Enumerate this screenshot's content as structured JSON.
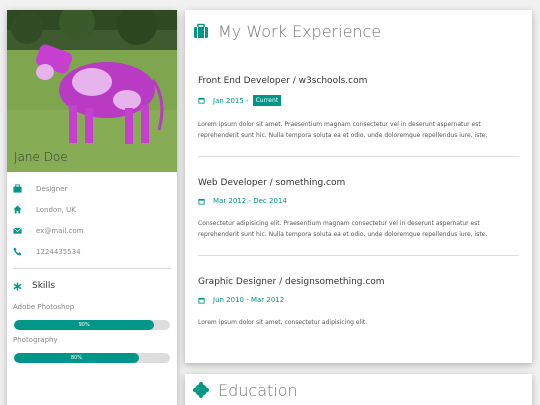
{
  "profile": {
    "name": "Jane Doe",
    "info": [
      {
        "icon": "briefcase-icon",
        "text": "Designer"
      },
      {
        "icon": "home-icon",
        "text": "London, UK"
      },
      {
        "icon": "envelope-icon",
        "text": "ex@mail.com"
      },
      {
        "icon": "phone-icon",
        "text": "1224435534"
      }
    ],
    "skills_title": "Skills",
    "skills": [
      {
        "label": "Adobe Photoshop",
        "percent": 90,
        "percent_label": "90%"
      },
      {
        "label": "Photography",
        "percent": 80,
        "percent_label": "80%"
      }
    ]
  },
  "work": {
    "title": "My Work Experience",
    "jobs": [
      {
        "title": "Front End Developer / w3schools.com",
        "date": "Jan 2015 -",
        "badge": "Current",
        "desc": "Lorem ipsum dolor sit amet. Praesentium magnam consectetur vel in deserunt aspernatur est reprehenderit sunt hic. Nulla tempora soluta ea et odio, unde doloremque repellendus iure, iste."
      },
      {
        "title": "Web Developer / something.com",
        "date": "Mar 2012 - Dec 2014",
        "badge": "",
        "desc": "Consectetur adipisicing elit. Praesentium magnam consectetur vel in deserunt aspernatur est reprehenderit sunt hic. Nulla tempora soluta ea et odio, unde doloremque repellendus iure, iste."
      },
      {
        "title": "Graphic Designer / designsomething.com",
        "date": "Jun 2010 - Mar 2012",
        "badge": "",
        "desc": "Lorem ipsum dolor sit amet, consectetur adipisicing elit."
      }
    ]
  },
  "education": {
    "title": "Education"
  },
  "colors": {
    "accent": "#009688",
    "background": "#f1f1f1"
  }
}
